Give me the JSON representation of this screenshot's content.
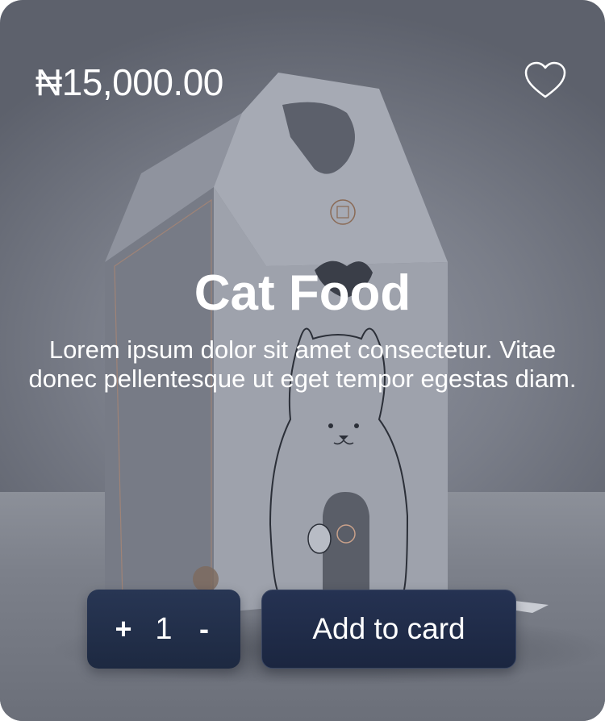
{
  "product": {
    "price": "₦15,000.00",
    "title": "Cat Food",
    "description": "Lorem ipsum dolor sit amet consectetur. Vitae donec pellentesque ut eget tempor egestas diam.",
    "image_icon": "cat-food-box-image"
  },
  "favorite": {
    "icon": "heart-outline-icon"
  },
  "stepper": {
    "plus_label": "+",
    "quantity": "1",
    "minus_label": "-"
  },
  "actions": {
    "add_label": "Add to card"
  },
  "colors": {
    "button_bg": "#1d2941",
    "text": "#ffffff",
    "card_bg": "#7a7e89"
  }
}
